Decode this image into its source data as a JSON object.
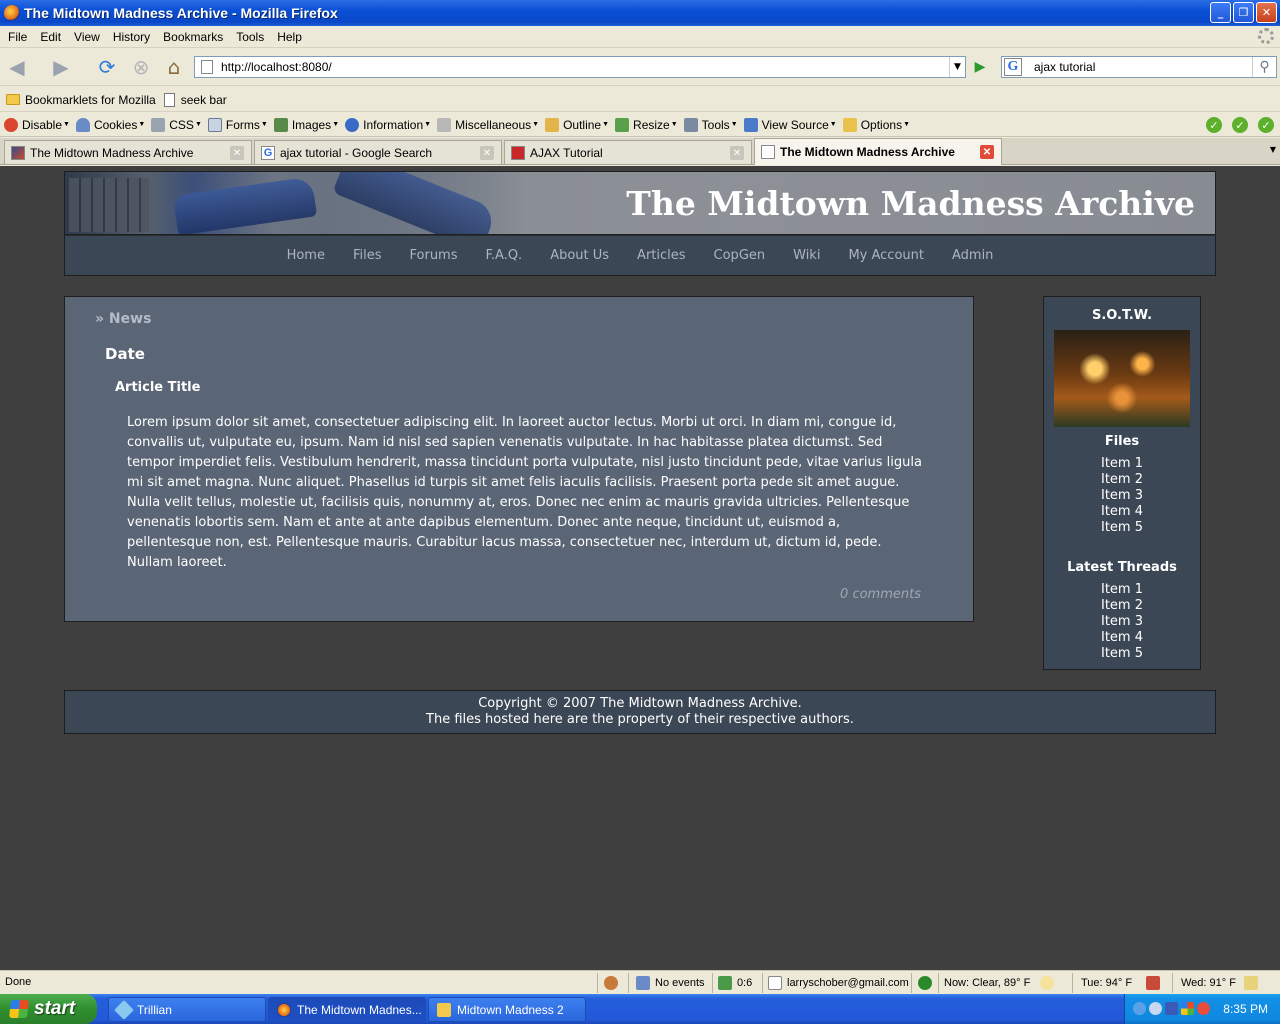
{
  "window": {
    "title": "The Midtown Madness Archive - Mozilla Firefox",
    "minimize": "_",
    "maximize": "❐",
    "close": "✕"
  },
  "menu": [
    "File",
    "Edit",
    "View",
    "History",
    "Bookmarks",
    "Tools",
    "Help"
  ],
  "navbar": {
    "url": "http://localhost:8080/",
    "search": "ajax tutorial"
  },
  "bookmarks": [
    "Bookmarklets for Mozilla",
    "seek bar"
  ],
  "devtools": [
    "Disable",
    "Cookies",
    "CSS",
    "Forms",
    "Images",
    "Information",
    "Miscellaneous",
    "Outline",
    "Resize",
    "Tools",
    "View Source",
    "Options"
  ],
  "tabs": [
    {
      "label": "The Midtown Madness Archive"
    },
    {
      "label": "ajax tutorial - Google Search"
    },
    {
      "label": "AJAX Tutorial"
    },
    {
      "label": "The Midtown Madness Archive"
    }
  ],
  "site": {
    "title": "The Midtown Madness Archive",
    "nav": [
      "Home",
      "Files",
      "Forums",
      "F.A.Q.",
      "About Us",
      "Articles",
      "CopGen",
      "Wiki",
      "My Account",
      "Admin"
    ],
    "news": {
      "crumb": "» News",
      "date": "Date",
      "article_title": "Article Title",
      "body": "Lorem ipsum dolor sit amet, consectetuer adipiscing elit. In laoreet auctor lectus. Morbi ut orci. In diam mi, congue id, convallis ut, vulputate eu, ipsum. Nam id nisl sed sapien venenatis vulputate. In hac habitasse platea dictumst. Sed tempor imperdiet felis. Vestibulum hendrerit, massa tincidunt porta vulputate, nisl justo tincidunt pede, vitae varius ligula mi sit amet magna. Nunc aliquet. Phasellus id turpis sit amet felis iaculis facilisis. Praesent porta pede sit amet augue. Nulla velit tellus, molestie ut, facilisis quis, nonummy at, eros. Donec nec enim ac mauris gravida ultricies. Pellentesque venenatis lobortis sem. Nam et ante at ante dapibus elementum. Donec ante neque, tincidunt ut, euismod a, pellentesque non, est. Pellentesque mauris. Curabitur lacus massa, consectetuer nec, interdum ut, dictum id, pede. Nullam laoreet.",
      "comments": "0 comments"
    },
    "sidebar": {
      "sotw": "S.O.T.W.",
      "files_title": "Files",
      "files": [
        "Item 1",
        "Item 2",
        "Item 3",
        "Item 4",
        "Item 5"
      ],
      "threads_title": "Latest Threads",
      "threads": [
        "Item 1",
        "Item 2",
        "Item 3",
        "Item 4",
        "Item 5"
      ]
    },
    "footer": {
      "line1": "Copyright © 2007 The Midtown Madness Archive.",
      "line2": "The files hosted here are the property of their respective authors."
    }
  },
  "status": {
    "done": "Done",
    "events": "No events",
    "count": "0:6",
    "email": "larryschober@gmail.com",
    "now": "Now: Clear, 89° F",
    "tue": "Tue: 94° F",
    "wed": "Wed: 91° F"
  },
  "taskbar": {
    "start": "start",
    "tasks": [
      "Trillian",
      "The Midtown Madnes...",
      "Midtown Madness 2"
    ],
    "clock": "8:35 PM"
  }
}
